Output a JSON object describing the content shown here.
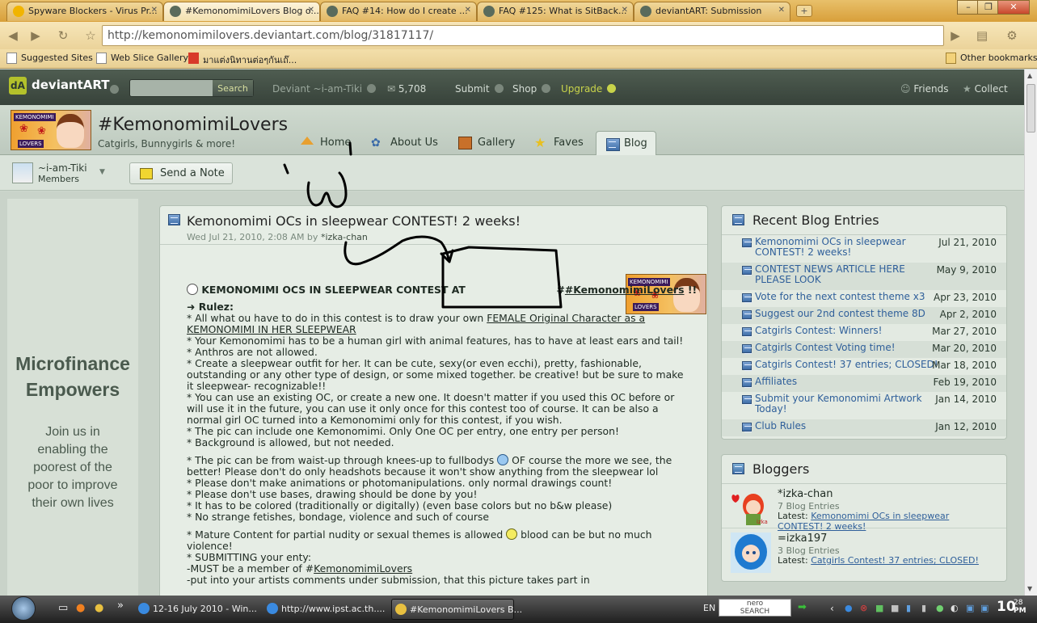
{
  "browser": {
    "tabs": [
      {
        "title": "Spyware Blockers - Virus Pr...",
        "color": "#f1b400"
      },
      {
        "title": "#KemonomimiLovers Blog o...",
        "color": "#5a6b5c"
      },
      {
        "title": "FAQ #14: How do I create ...",
        "color": "#5a6b5c"
      },
      {
        "title": "FAQ #125: What is SitBack...",
        "color": "#5a6b5c"
      },
      {
        "title": "deviantART: Submission",
        "color": "#5a6b5c"
      }
    ],
    "new_tab": "+",
    "url": "http://kemonomimilovers.deviantart.com/blog/31817117/",
    "bookmarks": [
      "Suggested Sites",
      "Web Slice Gallery",
      "มาแต่งนิทานต่อๆกันเถ๊..."
    ],
    "other_bookmarks": "Other bookmarks"
  },
  "da_bar": {
    "logo": "deviantART",
    "search_button": "Search",
    "user": "Deviant ~i-am-Tiki",
    "messages": "5,708",
    "submit": "Submit",
    "shop": "Shop",
    "upgrade": "Upgrade",
    "friends": "Friends",
    "collect": "Collect"
  },
  "group": {
    "name": "#KemonomimiLovers",
    "subtitle": "Catgirls, Bunnygirls & more!",
    "avatar_label_top": "KEMONOMIMI",
    "avatar_label_bottom": "LOVERS",
    "tabs": [
      "Home",
      "About Us",
      "Gallery",
      "Faves",
      "Blog"
    ],
    "member_name": "~i-am-Tiki",
    "member_role": "Members",
    "send_note": "Send a Note"
  },
  "ad": {
    "headline_1": "Microfinance",
    "headline_2": "Empowers",
    "body": [
      "Join us in",
      "enabling the",
      "poorest of the",
      "poor to improve",
      "their own lives"
    ]
  },
  "post": {
    "title": "Kemonomimi OCs in sleepwear CONTEST! 2 weeks!",
    "date": "Wed Jul 21, 2010, 2:08 AM by ",
    "author": "*izka-chan",
    "headline_pre": "KEMONOMIMI OCS IN SLEEPWEAR CONTEST AT",
    "headline_club": "#KemonomimiLovers",
    "headline_post": "!!",
    "rules_title": "Rulez:",
    "l1a": "* All what ou have to do in this contest is to draw your own ",
    "l1b": "FEMALE Original Character as a",
    "l2": "KEMONOMIMI IN HER SLEEPWEAR",
    "l3": "* Your Kemonomimi has to be a human girl with animal features, has to have at least ears and tail!",
    "l4": "* Anthros are not allowed.",
    "l5": "* Create a sleepwear outfit for her. It can be cute, sexy(or even ecchi), pretty, fashionable,",
    "l6": "outstanding or any other type of design, or some mixed together. be creative! but be sure to make",
    "l7": "it sleepwear- recognizable!!",
    "l8": "* You can use an existing OC, or create a new one. It doesn't matter if you used this OC before or",
    "l9": "will use it in the future, you can use it only once for this contest too of course. It can be also a",
    "l10": "normal girl OC turned into a Kemonomimi only for this contest, if you wish.",
    "l11": "* The pic can include one Kemonomimi. Only One OC per entry, one entry per person!",
    "l12": "* Background is allowed, but not needed.",
    "l13a": "* The pic can be from waist-up through knees-up to fullbodys ",
    "l13b": " OF course the more we see, the",
    "l14": "better! Please don't do only headshots because it won't show anything from the sleepwear lol",
    "l15": "* Please don't make animations or photomanipulations. only normal drawings count!",
    "l16": "* Please don't use bases, drawing should be done by you!",
    "l17": "* It has to be colored (traditionally or digitally) (even base colors but no b&w please)",
    "l18": "* No strange fetishes, bondage, violence and such of course",
    "l19a": "* Mature Content for partial nudity or sexual themes is allowed ",
    "l19b": " blood can be but no much",
    "l20": "violence!",
    "l21": "* SUBMITTING your enty:",
    "l22a": "-MUST be a member of #",
    "l22b": "KemonomimiLovers",
    "l23": "-put into your artists comments under submission, that this picture takes part in"
  },
  "recent": {
    "title": "Recent Blog Entries",
    "entries": [
      {
        "title": "Kemonomimi OCs in sleepwear CONTEST! 2 weeks!",
        "date": "Jul 21, 2010"
      },
      {
        "title": "CONTEST NEWS ARTICLE HERE PLEASE LOOK",
        "date": "May 9, 2010"
      },
      {
        "title": "Vote for the next contest theme x3",
        "date": "Apr 23, 2010"
      },
      {
        "title": "Suggest our 2nd contest theme 8D",
        "date": "Apr 2, 2010"
      },
      {
        "title": "Catgirls Contest: Winners!",
        "date": "Mar 27, 2010"
      },
      {
        "title": "Catgirls Contest Voting time!",
        "date": "Mar 20, 2010"
      },
      {
        "title": "Catgirls Contest! 37 entries; CLOSED!",
        "date": "Mar 18, 2010"
      },
      {
        "title": "Affiliates",
        "date": "Feb 19, 2010"
      },
      {
        "title": "Submit your Kemonomimi Artwork Today!",
        "date": "Jan 14, 2010"
      },
      {
        "title": "Club Rules",
        "date": "Jan 12, 2010"
      }
    ]
  },
  "bloggers": {
    "title": "Bloggers",
    "latest_label": "Latest: ",
    "list": [
      {
        "name": "*izka-chan",
        "count": "7 Blog Entries",
        "latest": "Kemonomimi OCs in sleepwear CONTEST! 2 weeks!",
        "avatar_tag": "izka"
      },
      {
        "name": "=izka197",
        "count": "3 Blog Entries",
        "latest": "Catgirls Contest! 37 entries; CLOSED!",
        "avatar_tag": ""
      }
    ]
  },
  "taskbar": {
    "tasks": [
      "12-16 July 2010 - Win...",
      "http://www.ipst.ac.th....",
      "#KemonomimiLovers B..."
    ],
    "lang": "EN",
    "search_brand": "nero",
    "search_sub": "SEARCH",
    "clock_main": "10",
    "clock_min": "28",
    "clock_ampm": "PM"
  }
}
